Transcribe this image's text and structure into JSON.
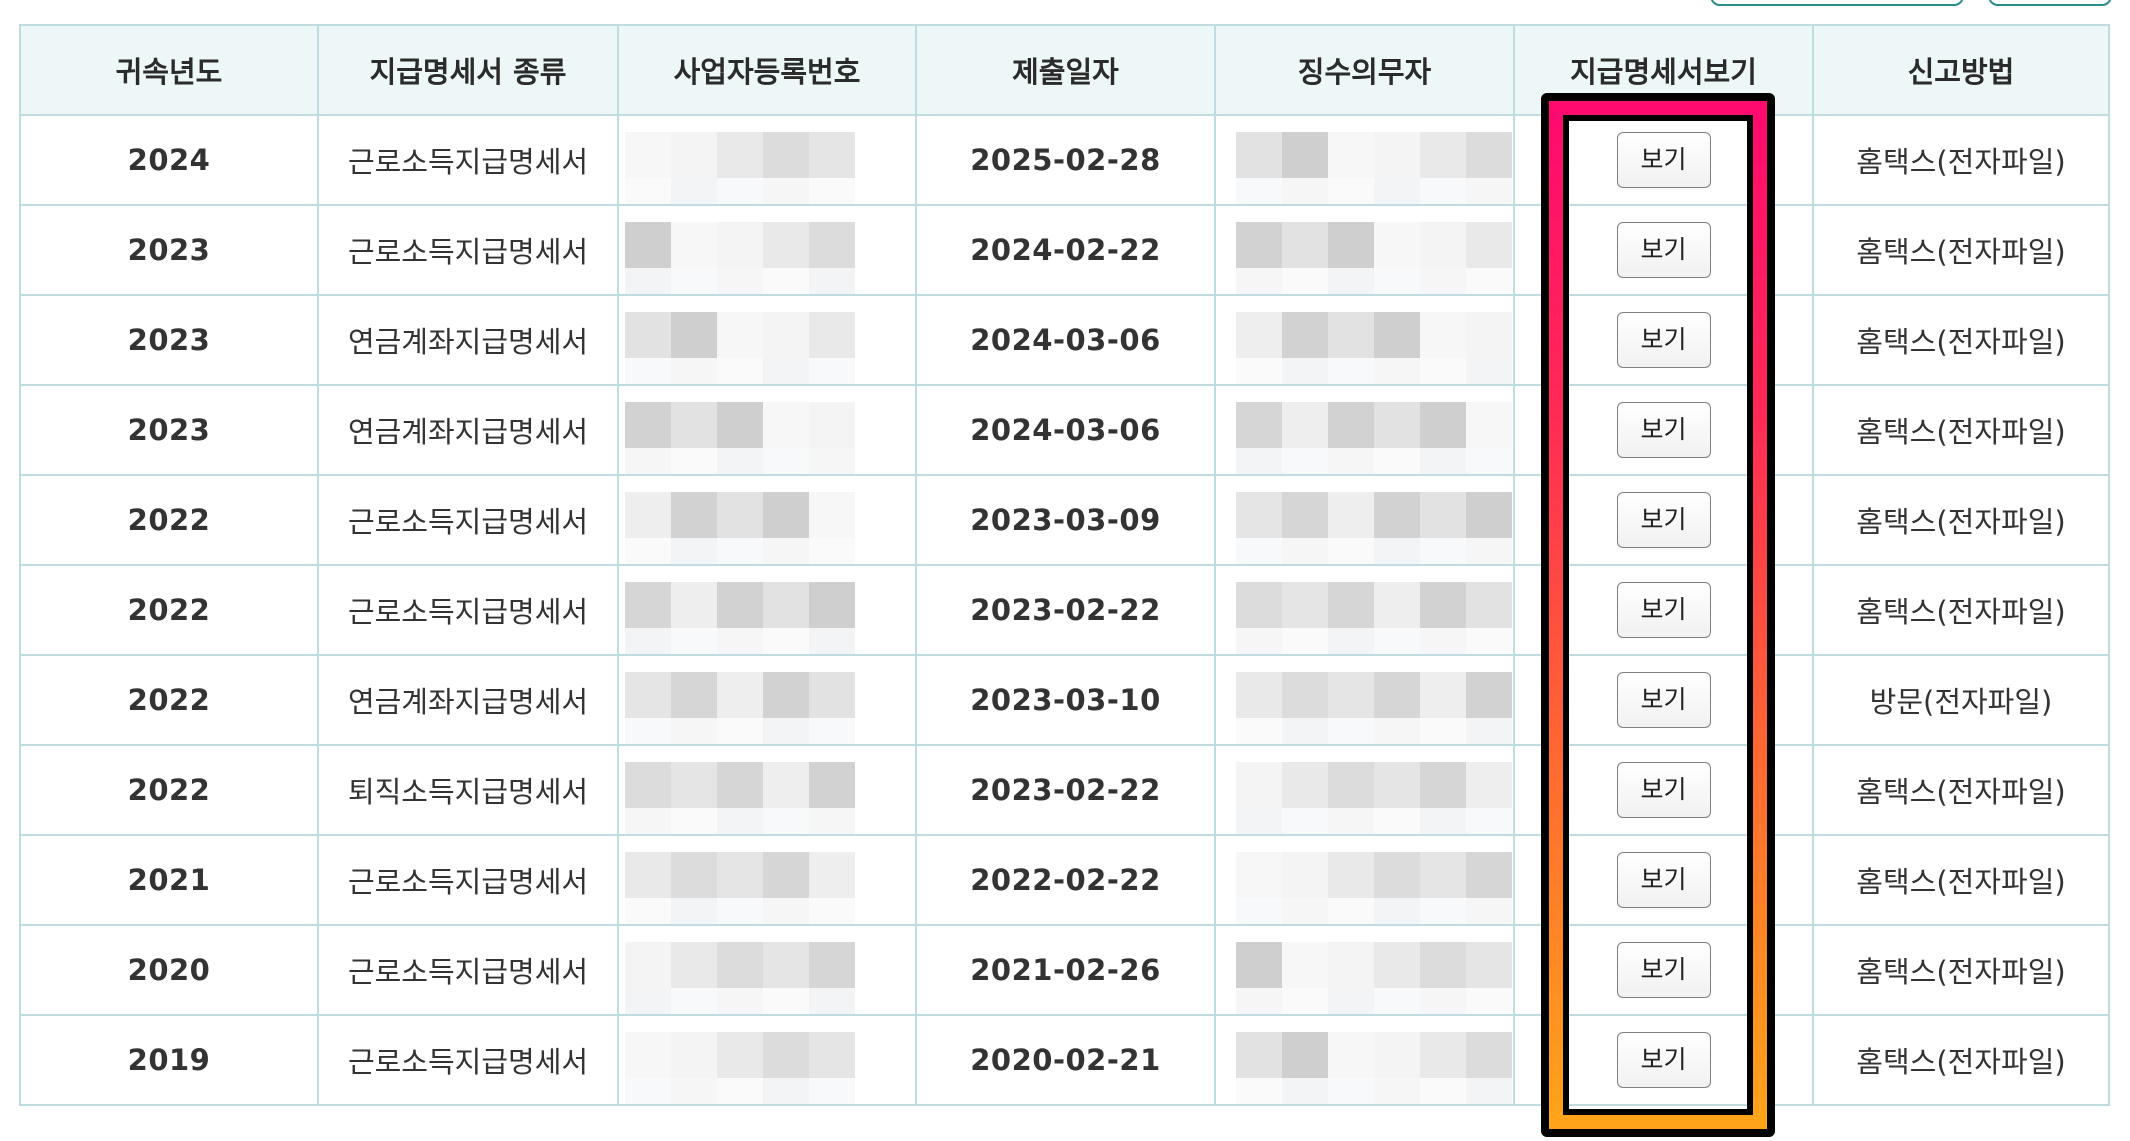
{
  "columns": {
    "year": "귀속년도",
    "kind": "지급명세서 종류",
    "biz_no": "사업자등록번호",
    "date": "제출일자",
    "payer": "징수의무자",
    "view": "지급명세서보기",
    "method": "신고방법"
  },
  "rows": [
    {
      "year": "2024",
      "kind": "근로소득지급명세서",
      "date": "2025-02-28",
      "view": "보기",
      "method": "홈택스(전자파일)"
    },
    {
      "year": "2023",
      "kind": "근로소득지급명세서",
      "date": "2024-02-22",
      "view": "보기",
      "method": "홈택스(전자파일)"
    },
    {
      "year": "2023",
      "kind": "연금계좌지급명세서",
      "date": "2024-03-06",
      "view": "보기",
      "method": "홈택스(전자파일)"
    },
    {
      "year": "2023",
      "kind": "연금계좌지급명세서",
      "date": "2024-03-06",
      "view": "보기",
      "method": "홈택스(전자파일)"
    },
    {
      "year": "2022",
      "kind": "근로소득지급명세서",
      "date": "2023-03-09",
      "view": "보기",
      "method": "홈택스(전자파일)"
    },
    {
      "year": "2022",
      "kind": "근로소득지급명세서",
      "date": "2023-02-22",
      "view": "보기",
      "method": "홈택스(전자파일)"
    },
    {
      "year": "2022",
      "kind": "연금계좌지급명세서",
      "date": "2023-03-10",
      "view": "보기",
      "method": "방문(전자파일)"
    },
    {
      "year": "2022",
      "kind": "퇴직소득지급명세서",
      "date": "2023-02-22",
      "view": "보기",
      "method": "홈택스(전자파일)"
    },
    {
      "year": "2021",
      "kind": "근로소득지급명세서",
      "date": "2022-02-22",
      "view": "보기",
      "method": "홈택스(전자파일)"
    },
    {
      "year": "2020",
      "kind": "근로소득지급명세서",
      "date": "2021-02-26",
      "view": "보기",
      "method": "홈택스(전자파일)"
    },
    {
      "year": "2019",
      "kind": "근로소득지급명세서",
      "date": "2020-02-21",
      "view": "보기",
      "method": "홈택스(전자파일)"
    }
  ],
  "colors": {
    "header_bg": "#eef7f7",
    "border": "#bfdde0",
    "highlight_top": "#ff0a6e",
    "highlight_bottom": "#ffa31a"
  }
}
